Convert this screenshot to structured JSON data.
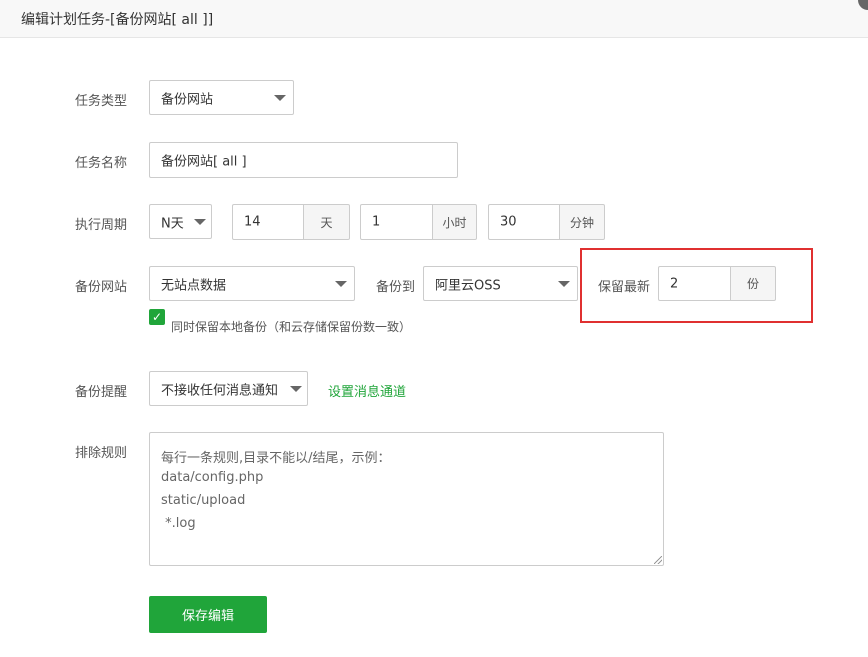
{
  "header": {
    "title": "编辑计划任务-[备份网站[ all ]]"
  },
  "form": {
    "task_type": {
      "label": "任务类型",
      "value": "备份网站"
    },
    "task_name": {
      "label": "任务名称",
      "value": "备份网站[ all ]"
    },
    "cycle": {
      "label": "执行周期",
      "unit_select": "N天",
      "days": "14",
      "days_unit": "天",
      "hours": "1",
      "hours_unit": "小时",
      "minutes": "30",
      "minutes_unit": "分钟"
    },
    "backup_site": {
      "label": "备份网站",
      "site_select": "无站点数据",
      "to_label": "备份到",
      "to_select": "阿里云OSS",
      "keep_label": "保留最新",
      "keep_value": "2",
      "keep_unit": "份",
      "keep_local_checked": true,
      "keep_local_label": "同时保留本地备份（和云存储保留份数一致）"
    },
    "notify": {
      "label": "备份提醒",
      "select": "不接收任何消息通知",
      "link": "设置消息通道"
    },
    "exclude": {
      "label": "排除规则",
      "placeholder_lines": [
        "每行一条规则,目录不能以/结尾，示例：",
        "data/config.php",
        "static/upload",
        " *.log"
      ]
    },
    "save_button": "保存编辑"
  },
  "colors": {
    "accent": "#20a53a",
    "highlight": "#e03030"
  }
}
